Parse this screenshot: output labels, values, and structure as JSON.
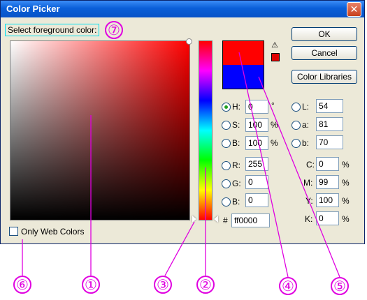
{
  "window": {
    "title": "Color Picker",
    "close_glyph": "✕"
  },
  "label": {
    "foreground": "Select foreground color:"
  },
  "buttons": {
    "ok": "OK",
    "cancel": "Cancel",
    "libraries": "Color Libraries"
  },
  "hsb": [
    {
      "key": "H:",
      "value": "0",
      "unit": "°",
      "selected": true
    },
    {
      "key": "S:",
      "value": "100",
      "unit": "%",
      "selected": false
    },
    {
      "key": "B:",
      "value": "100",
      "unit": "%",
      "selected": false
    }
  ],
  "rgb": [
    {
      "key": "R:",
      "value": "255"
    },
    {
      "key": "G:",
      "value": "0"
    },
    {
      "key": "B:",
      "value": "0"
    }
  ],
  "lab": [
    {
      "key": "L:",
      "value": "54"
    },
    {
      "key": "a:",
      "value": "81"
    },
    {
      "key": "b:",
      "value": "70"
    }
  ],
  "cmyk": [
    {
      "key": "C:",
      "value": "0",
      "unit": "%"
    },
    {
      "key": "M:",
      "value": "99",
      "unit": "%"
    },
    {
      "key": "Y:",
      "value": "100",
      "unit": "%"
    },
    {
      "key": "K:",
      "value": "0",
      "unit": "%"
    }
  ],
  "hex": {
    "prefix": "#",
    "value": "ff0000"
  },
  "web_colors": {
    "label": "Only Web Colors"
  },
  "annotations": [
    "①",
    "②",
    "③",
    "④",
    "⑤",
    "⑥",
    "⑦"
  ],
  "colors": {
    "new_color": "#ff0000",
    "current_color": "#0000ff",
    "annotation": "#e000e0"
  }
}
